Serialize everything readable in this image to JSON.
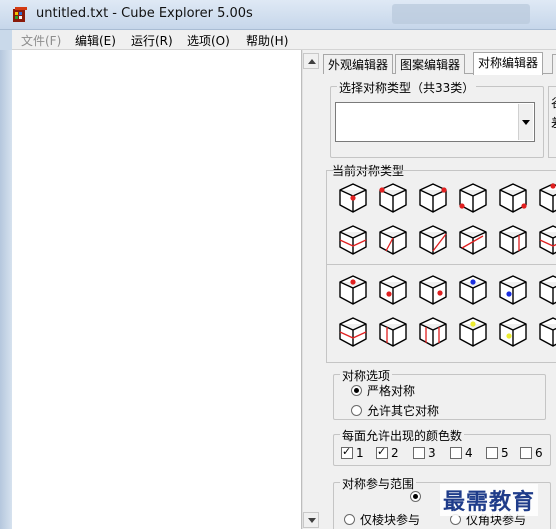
{
  "window": {
    "title": "untitled.txt - Cube Explorer 5.00s",
    "app_icon": "cube-app-icon"
  },
  "menu": {
    "items": [
      {
        "label": "文件(F)",
        "disabled": true
      },
      {
        "label": "编辑(E)",
        "disabled": false
      },
      {
        "label": "运行(R)",
        "disabled": false
      },
      {
        "label": "选项(O)",
        "disabled": false
      },
      {
        "label": "帮助(H)",
        "disabled": false
      }
    ]
  },
  "tabs": [
    {
      "label": "外观编辑器",
      "active": false
    },
    {
      "label": "图案编辑器",
      "active": false
    },
    {
      "label": "对称编辑器",
      "active": true
    }
  ],
  "symmetry_select": {
    "legend": "选择对称类型（共33类）",
    "value": ""
  },
  "side_glyphs": [
    "谷",
    "差"
  ],
  "current_symmetry": {
    "legend": "当前对称类型"
  },
  "symmetry_options": {
    "legend": "对称选项",
    "strict": "严格对称",
    "allow_other": "允许其它对称",
    "selected": "strict"
  },
  "colors_per_face": {
    "legend": "每面允许出现的颜色数",
    "items": [
      {
        "label": "1",
        "checked": true
      },
      {
        "label": "2",
        "checked": true
      },
      {
        "label": "3",
        "checked": false
      },
      {
        "label": "4",
        "checked": false
      },
      {
        "label": "5",
        "checked": false
      },
      {
        "label": "6",
        "checked": false
      }
    ]
  },
  "participation": {
    "legend": "对称参与范围",
    "edges_only": "仅棱块参与",
    "corners_only": "仅角块参与"
  },
  "watermark": "最需教育",
  "colors": {
    "title_bg": "#c6d6ea",
    "menu_bg": "#f0f0f0",
    "panel_bg": "#f0f0f0",
    "red": "#e02020",
    "blue": "#1a2ee0",
    "yellow": "#ecec30",
    "watermark": "#1f3c8a"
  }
}
